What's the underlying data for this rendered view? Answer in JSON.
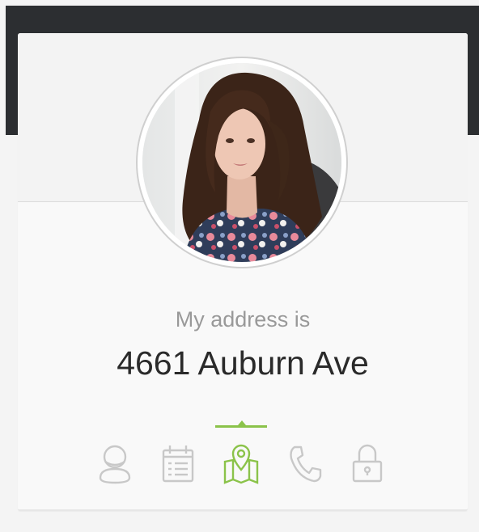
{
  "profile": {
    "title": "My address is",
    "value": "4661 Auburn Ave"
  },
  "tabs": [
    {
      "name": "name",
      "icon": "user-icon",
      "active": false
    },
    {
      "name": "birthday",
      "icon": "calendar-icon",
      "active": false
    },
    {
      "name": "location",
      "icon": "map-icon",
      "active": true
    },
    {
      "name": "phone",
      "icon": "phone-icon",
      "active": false
    },
    {
      "name": "password",
      "icon": "lock-icon",
      "active": false
    }
  ],
  "colors": {
    "header_bg": "#2c2e31",
    "accent": "#8bc34a",
    "icon_inactive": "#c8c8c8",
    "title_text": "#999999",
    "value_text": "#2a2a2a"
  }
}
